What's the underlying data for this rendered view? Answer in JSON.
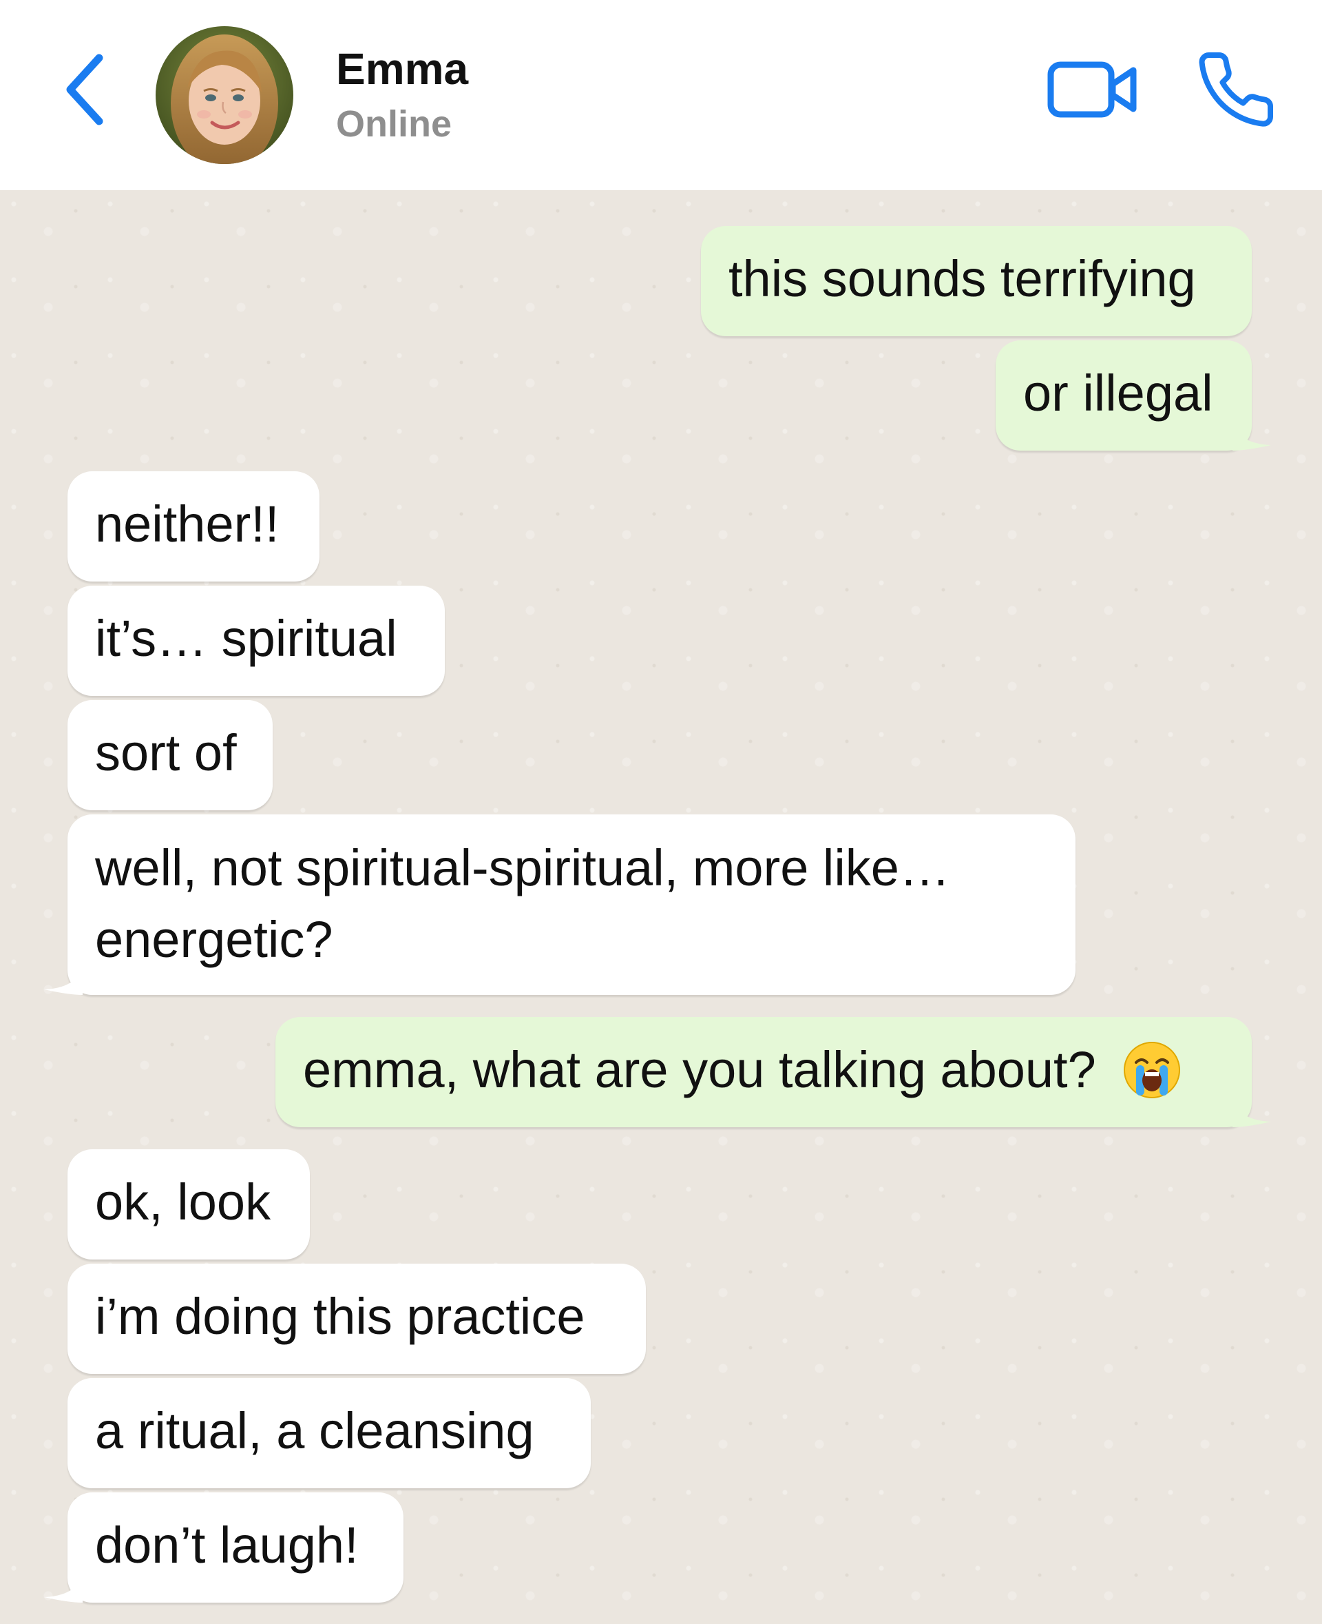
{
  "header": {
    "contact_name": "Emma",
    "status": "Online"
  },
  "colors": {
    "accent": "#1a7cf0",
    "outgoing_bubble": "#e5f8d7",
    "incoming_bubble": "#ffffff",
    "chat_background": "#ebe6df"
  },
  "icons": {
    "back": "chevron-left-icon",
    "video": "video-camera-icon",
    "call": "phone-icon",
    "crying": "loudly-crying-face-emoji"
  },
  "messages": [
    {
      "direction": "outgoing",
      "text": "this sounds terrifying"
    },
    {
      "direction": "outgoing",
      "text": "or illegal"
    },
    {
      "direction": "incoming",
      "text": "neither!!"
    },
    {
      "direction": "incoming",
      "text": "it’s… spiritual"
    },
    {
      "direction": "incoming",
      "text": "sort of"
    },
    {
      "direction": "incoming",
      "text": "well, not spiritual-spiritual, more like… energetic?"
    },
    {
      "direction": "outgoing",
      "text": "emma, what are you talking about?"
    },
    {
      "direction": "incoming",
      "text": "ok, look"
    },
    {
      "direction": "incoming",
      "text": "i’m doing this practice"
    },
    {
      "direction": "incoming",
      "text": "a ritual, a cleansing"
    },
    {
      "direction": "incoming",
      "text": "don’t laugh!"
    }
  ]
}
